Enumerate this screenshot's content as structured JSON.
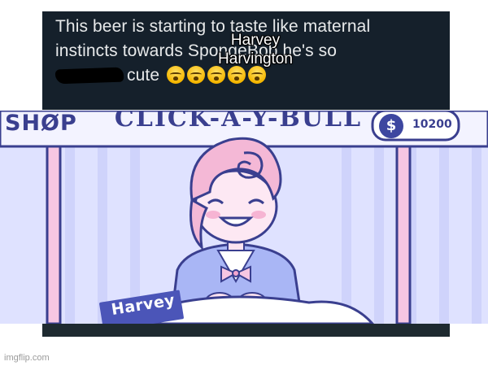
{
  "tweet": {
    "line1": "This beer is starting to taste like maternal",
    "line2": "instincts towards SpongeBob he's so",
    "line3_word": "cute",
    "emoji_name": "loudly-crying-face-emoji",
    "emoji_count": 5
  },
  "caption": {
    "line1": "Harvey",
    "line2": "Harvington"
  },
  "scene": {
    "shop_label": "SHØP",
    "banner_text": "CLICK-A-Y-BULL",
    "coin_symbol": "$",
    "coin_count": "10200",
    "nametag": "Harvey"
  },
  "watermark": "imgflip.com",
  "colors": {
    "tweet_bg": "#15202b",
    "scene_bg": "#dfe2ff",
    "accent": "#3a3f8f",
    "hair": "#f4b8d6",
    "suit": "#a9b6f5"
  }
}
